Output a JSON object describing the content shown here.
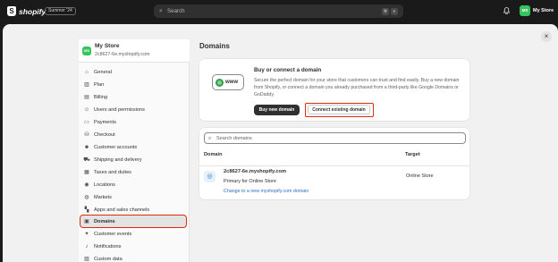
{
  "topbar": {
    "logo_glyph": "S",
    "logo_text": "shopify",
    "edition": "Summer '24",
    "search_placeholder": "Search",
    "shortcut_keys": [
      "⌘",
      "K"
    ],
    "avatar_initials": "MS",
    "store_name": "My Store"
  },
  "close_glyph": "×",
  "sidebar": {
    "avatar_initials": "MS",
    "store_name": "My Store",
    "store_domain": "2c8627-6e.myshopify.com",
    "items": [
      {
        "label": "General",
        "icon": "⌂"
      },
      {
        "label": "Plan",
        "icon": "▥"
      },
      {
        "label": "Billing",
        "icon": "▤"
      },
      {
        "label": "Users and permissions",
        "icon": "☺"
      },
      {
        "label": "Payments",
        "icon": "▭"
      },
      {
        "label": "Checkout",
        "icon": "⛁"
      },
      {
        "label": "Customer accounts",
        "icon": "☻"
      },
      {
        "label": "Shipping and delivery",
        "icon": "⛟"
      },
      {
        "label": "Taxes and duties",
        "icon": "▦"
      },
      {
        "label": "Locations",
        "icon": "◉"
      },
      {
        "label": "Markets",
        "icon": "◍"
      },
      {
        "label": "Apps and sales channels",
        "icon": "▚"
      },
      {
        "label": "Domains",
        "icon": "▣"
      },
      {
        "label": "Customer events",
        "icon": "✦"
      },
      {
        "label": "Notifications",
        "icon": "♪"
      },
      {
        "label": "Custom data",
        "icon": "▨"
      }
    ],
    "active_item": "Domains"
  },
  "main": {
    "title": "Domains",
    "buy_card": {
      "icon_text": "www",
      "title": "Buy or connect a domain",
      "body": "Secure the perfect domain for your store that customers can trust and find easily. Buy a new domain from Shopify, or connect a domain you already purchased from a third-party like Google Domains or GoDaddy.",
      "buy_button": "Buy new domain",
      "connect_button": "Connect existing domain"
    },
    "domains_card": {
      "search_placeholder": "Search domains",
      "col_domain": "Domain",
      "col_target": "Target",
      "rows": [
        {
          "domain": "2c8627-6e.myshopify.com",
          "sub": "Primary for Online Store",
          "link": "Change to a new myshopify.com domain",
          "target": "Online Store"
        }
      ]
    }
  }
}
